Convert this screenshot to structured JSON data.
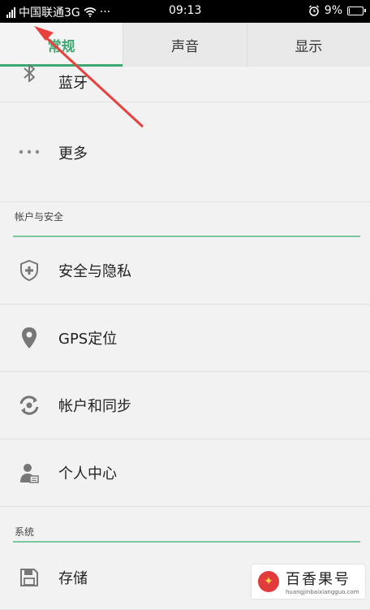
{
  "status_bar": {
    "carrier": "中国联通3G",
    "extra": "···",
    "time": "09:13",
    "battery_percent": "9%",
    "battery_level": 0.09,
    "icons": [
      "signal-icon",
      "wifi-icon",
      "alarm-icon",
      "battery-icon"
    ]
  },
  "tabs": [
    {
      "label": "常规",
      "active": true
    },
    {
      "label": "声音",
      "active": false
    },
    {
      "label": "显示",
      "active": false
    }
  ],
  "rows_top": [
    {
      "label": "蓝牙",
      "icon": "bluetooth-icon"
    },
    {
      "label": "更多",
      "icon": "more-dots-icon"
    }
  ],
  "section_account": {
    "title": "帐户与安全"
  },
  "rows_account": [
    {
      "label": "安全与隐私",
      "icon": "shield-icon"
    },
    {
      "label": "GPS定位",
      "icon": "location-pin-icon"
    },
    {
      "label": "帐户和同步",
      "icon": "sync-icon"
    },
    {
      "label": "个人中心",
      "icon": "person-icon"
    }
  ],
  "section_system": {
    "title": "系统"
  },
  "rows_system": [
    {
      "label": "存储",
      "icon": "storage-icon"
    }
  ],
  "watermark": {
    "text": "百香果号",
    "url": "huangjinbaixiangguo.com"
  },
  "colors": {
    "accent": "#3fa872",
    "divider": "#7cc7a1",
    "arrow": "#e8403c"
  }
}
